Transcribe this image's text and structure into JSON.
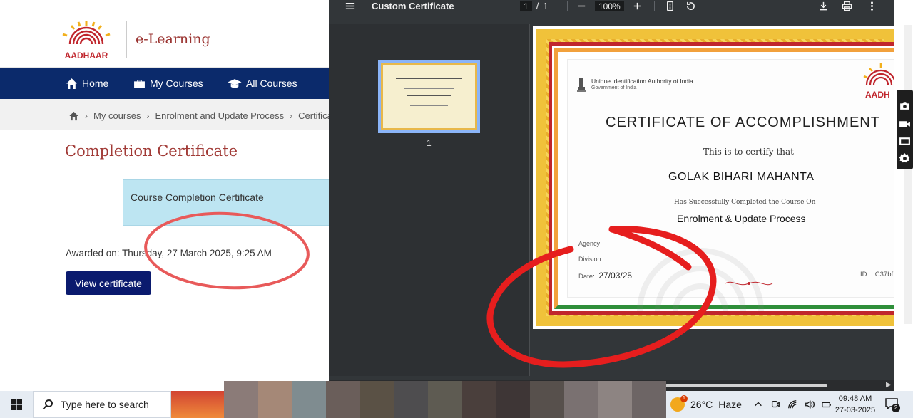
{
  "lms": {
    "brand": "e-Learning",
    "logo_text": "AADHAAR",
    "nav": [
      {
        "label": "Home"
      },
      {
        "label": "My Courses"
      },
      {
        "label": "All Courses"
      }
    ],
    "breadcrumb": [
      "My courses",
      "Enrolment and Update Process",
      "Certifica"
    ],
    "page_title": "Completion Certificate",
    "certificate_box": "Course Completion Certificate",
    "awarded": "Awarded on: Thursday, 27 March 2025, 9:25 AM",
    "view_button": "View certificate"
  },
  "viewer": {
    "title": "Custom Certificate",
    "page_current": "1",
    "page_sep": "/",
    "page_total": "1",
    "zoom": "100%",
    "thumb_label": "1"
  },
  "certificate": {
    "org": "Unique Identification Authority of India",
    "org_sub": "Government of India",
    "logo_text": "AADH",
    "title": "CERTIFICATE OF ACCOMPLISHMENT",
    "certify": "This is to certify that",
    "name": "GOLAK BIHARI MAHANTA",
    "has_completed": "Has Successfully Completed the Course On",
    "course": "Enrolment & Update Process",
    "agency_label": "Agency",
    "division_label": "Division:",
    "date_label": "Date:",
    "date_value": "27/03/25",
    "id_label": "ID:",
    "id_value": "C37bf"
  },
  "taskbar": {
    "search_placeholder": "Type here to search",
    "temperature": "26°C",
    "weather": "Haze",
    "weather_badge": "1",
    "time": "09:48 AM",
    "date": "27-03-2025",
    "notifications": "2"
  },
  "colors": {
    "navbar": "#0b2a6b",
    "title_red": "#a13a36",
    "button_blue": "#0a1a6e",
    "annotation_red": "#e61e1e",
    "viewer_bg": "#323639"
  }
}
